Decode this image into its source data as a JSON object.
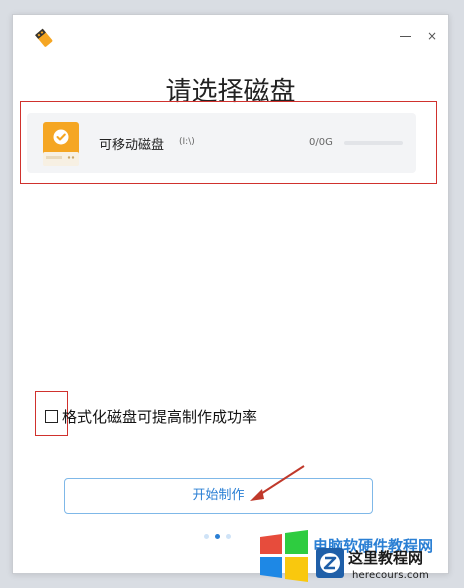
{
  "window": {
    "title": "请选择磁盘",
    "minimize_label": "—",
    "close_label": "×"
  },
  "disk": {
    "name": "可移动磁盘",
    "path": "(I:\\)",
    "size": "0/0G",
    "usage_fraction": 0
  },
  "format_option": {
    "label": "格式化磁盘可提高制作成功率",
    "checked": false
  },
  "start_button": {
    "label": "开始制作"
  },
  "pager": {
    "total": 3,
    "active_index": 1
  },
  "watermark": {
    "site_text": "电脑软硬件教程网",
    "brand": "这里教程网",
    "domain": "herecours.com"
  },
  "colors": {
    "accent": "#2a7fd4",
    "disk_orange": "#f5a623",
    "annotation_red": "#d0312d",
    "arrow_red": "#c0392b"
  }
}
